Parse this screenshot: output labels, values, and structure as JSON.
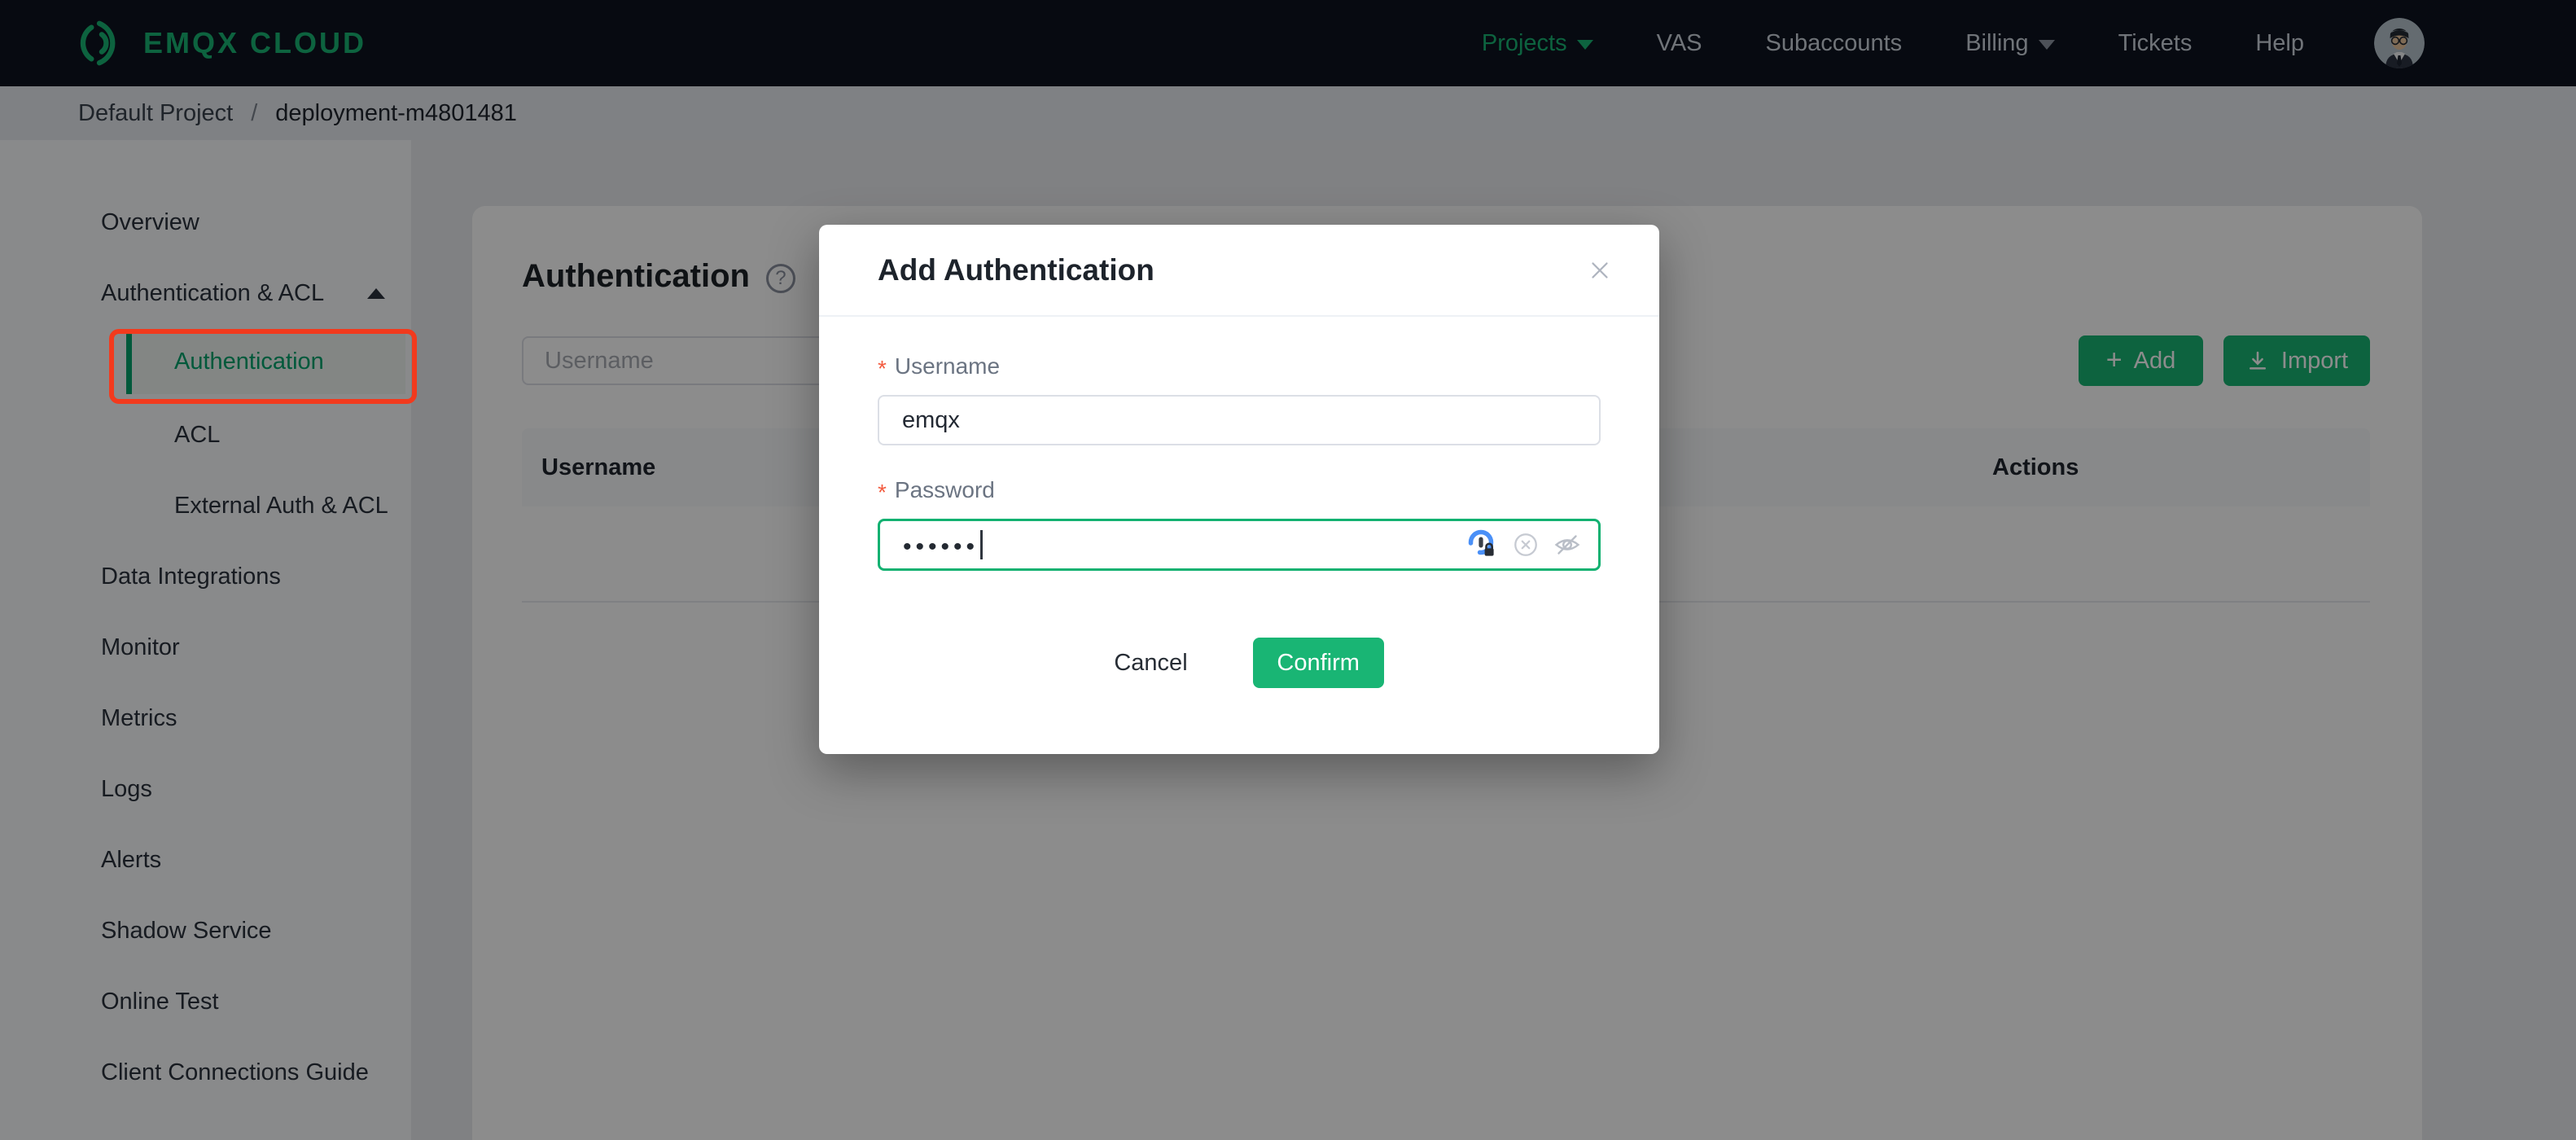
{
  "colors": {
    "accent_green": "#19b574",
    "active_menu_green": "#00a36c",
    "annotation_red": "#f23a1d",
    "navbar_bg": "#0d131f",
    "focus_border_green": "#12b171",
    "required_star": "#f35b3f"
  },
  "navbar": {
    "brand": "EMQX CLOUD",
    "items": [
      {
        "label": "Projects",
        "accent": true,
        "has_caret": true
      },
      {
        "label": "VAS"
      },
      {
        "label": "Subaccounts"
      },
      {
        "label": "Billing",
        "has_caret": true
      },
      {
        "label": "Tickets"
      },
      {
        "label": "Help"
      }
    ]
  },
  "breadcrumb": {
    "root": "Default Project",
    "separator": "/",
    "current": "deployment-m4801481"
  },
  "sidebar": {
    "items": [
      {
        "label": "Overview"
      },
      {
        "label": "Authentication & ACL",
        "expanded": true
      },
      {
        "label": "Authentication",
        "active": true,
        "annotated": true
      },
      {
        "label": "ACL"
      },
      {
        "label": "External Auth & ACL"
      },
      {
        "label": "Data Integrations"
      },
      {
        "label": "Monitor"
      },
      {
        "label": "Metrics"
      },
      {
        "label": "Logs"
      },
      {
        "label": "Alerts"
      },
      {
        "label": "Shadow Service"
      },
      {
        "label": "Online Test"
      },
      {
        "label": "Client Connections Guide"
      }
    ]
  },
  "main": {
    "title": "Authentication",
    "search_placeholder": "Username",
    "add_button": "Add",
    "import_button": "Import",
    "table": {
      "columns": [
        "Username",
        "Actions"
      ],
      "rows": []
    }
  },
  "modal": {
    "title": "Add Authentication",
    "username_label": "Username",
    "username_value": "emqx",
    "password_label": "Password",
    "password_masked_value": "••••••",
    "cancel_label": "Cancel",
    "confirm_label": "Confirm"
  }
}
